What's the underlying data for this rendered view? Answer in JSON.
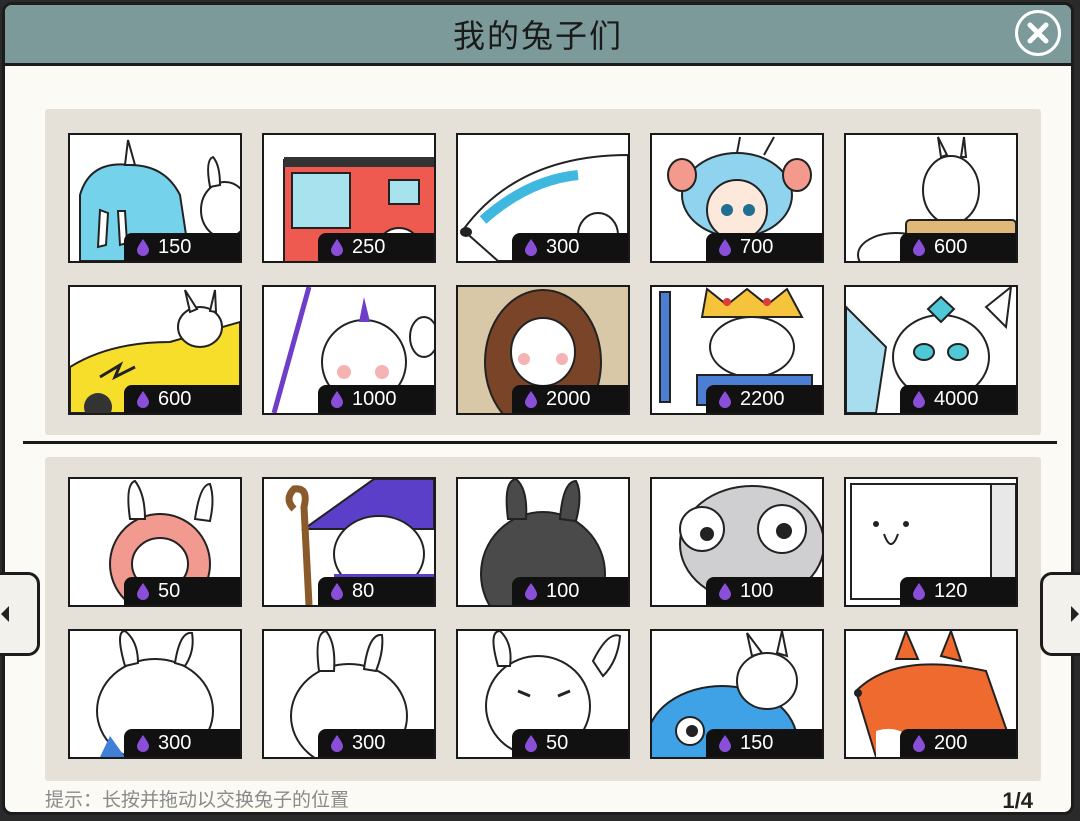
{
  "header": {
    "title": "我的兔子们"
  },
  "top_grid": [
    {
      "price": "150"
    },
    {
      "price": "250"
    },
    {
      "price": "300"
    },
    {
      "price": "700"
    },
    {
      "price": "600"
    },
    {
      "price": "600"
    },
    {
      "price": "1000"
    },
    {
      "price": "2000"
    },
    {
      "price": "2200"
    },
    {
      "price": "4000"
    }
  ],
  "bottom_grid": [
    {
      "price": "50"
    },
    {
      "price": "80"
    },
    {
      "price": "100"
    },
    {
      "price": "100"
    },
    {
      "price": "120"
    },
    {
      "price": "300"
    },
    {
      "price": "300"
    },
    {
      "price": "50"
    },
    {
      "price": "150"
    },
    {
      "price": "200"
    }
  ],
  "footer": {
    "hint": "提示：长按并拖动以交换兔子的位置",
    "page": "1/4"
  },
  "colors": {
    "titlebar": "#7b9a99",
    "panel": "#e6e1d8",
    "drop": "#8a4fd8"
  },
  "icons": {
    "close": "close-icon",
    "currency": "water-drop-icon",
    "prev": "arrow-left-icon",
    "next": "arrow-right-icon"
  }
}
